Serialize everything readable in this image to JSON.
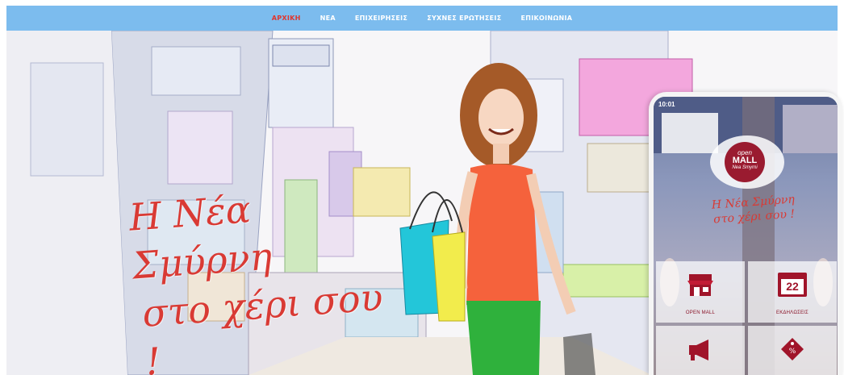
{
  "nav": {
    "items": [
      {
        "label": "ΑΡΧΙΚΗ",
        "active": true
      },
      {
        "label": "ΝΕΑ",
        "active": false
      },
      {
        "label": "ΕΠΙΧΕΙΡΗΣΕΙΣ",
        "active": false
      },
      {
        "label": "ΣΥΧΝΕΣ ΕΡΩΤΗΣΕΙΣ",
        "active": false
      },
      {
        "label": "ΕΠΙΚΟΙΝΩΝΙΑ",
        "active": false
      }
    ]
  },
  "hero": {
    "slogan_line1": "Η Νέα Σμύρνη",
    "slogan_line2": "στο χέρι σου !"
  },
  "phone": {
    "status_time": "10:01",
    "logo": {
      "open": "open",
      "mall": "MALL",
      "sub": "Nea Smyrni"
    },
    "slogan_line1": "Η Νέα Σμύρνη",
    "slogan_line2": "στο χέρι σου !",
    "tiles": [
      {
        "label": "OPEN MALL",
        "icon": "store-icon"
      },
      {
        "label": "ΕΚΔΗΛΩΣΕΙΣ",
        "icon": "calendar-icon",
        "value": "22"
      },
      {
        "label": "",
        "icon": "megaphone-icon"
      },
      {
        "label": "",
        "icon": "discount-tag-icon"
      }
    ]
  },
  "colors": {
    "nav_bg": "#7cbcee",
    "nav_active": "#e0352d",
    "slogan": "#d93a34",
    "brand": "#9a1b30"
  }
}
